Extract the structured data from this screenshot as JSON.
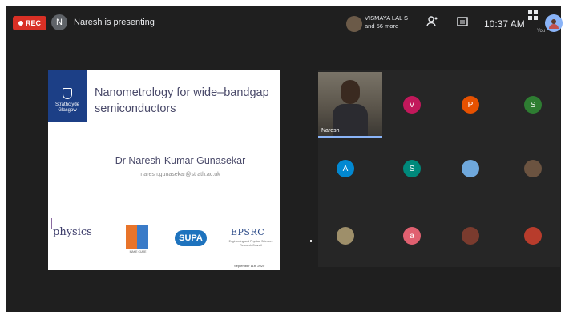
{
  "topbar": {
    "rec_label": "REC",
    "presenter_initial": "N",
    "presenting_text": "Naresh is presenting",
    "people_name": "VISMAYA LAL S",
    "people_more": "and 56 more",
    "time": "10:37 AM",
    "you_label": "You"
  },
  "slide": {
    "logo_text": "Strathclyde",
    "logo_sub": "Glasgow",
    "title_line1": "Nanometrology for wide–bandgap",
    "title_line2": "semiconductors",
    "author": "Dr Naresh-Kumar Gunasekar",
    "email": "naresh.gunasekar@strath.ac.uk",
    "physics_logo": "physics",
    "maker_caption": "MAKE CURE",
    "supa_logo": "SUPA",
    "epsrc_logo": "EPSRC",
    "epsrc_sub": "Engineering and Physical Sciences Research Council",
    "date": "September 11th 2020"
  },
  "participants": {
    "video_name": "Naresh",
    "tiles": [
      {
        "initial": "V",
        "color": "#c2185b"
      },
      {
        "initial": "P",
        "color": "#e65100"
      },
      {
        "initial": "S",
        "color": "#2e7d32"
      },
      {
        "initial": "A",
        "color": "#0288d1"
      },
      {
        "initial": "S",
        "color": "#00897b"
      },
      {
        "initial": "",
        "color": "#6fa8dc"
      },
      {
        "initial": "",
        "color": "#6b5340"
      },
      {
        "initial": "",
        "color": "#9e8f6a"
      },
      {
        "initial": "a",
        "color": "#e06070"
      },
      {
        "initial": "",
        "color": "#7a3b2e"
      },
      {
        "initial": "",
        "color": "#b83c2c"
      }
    ]
  }
}
